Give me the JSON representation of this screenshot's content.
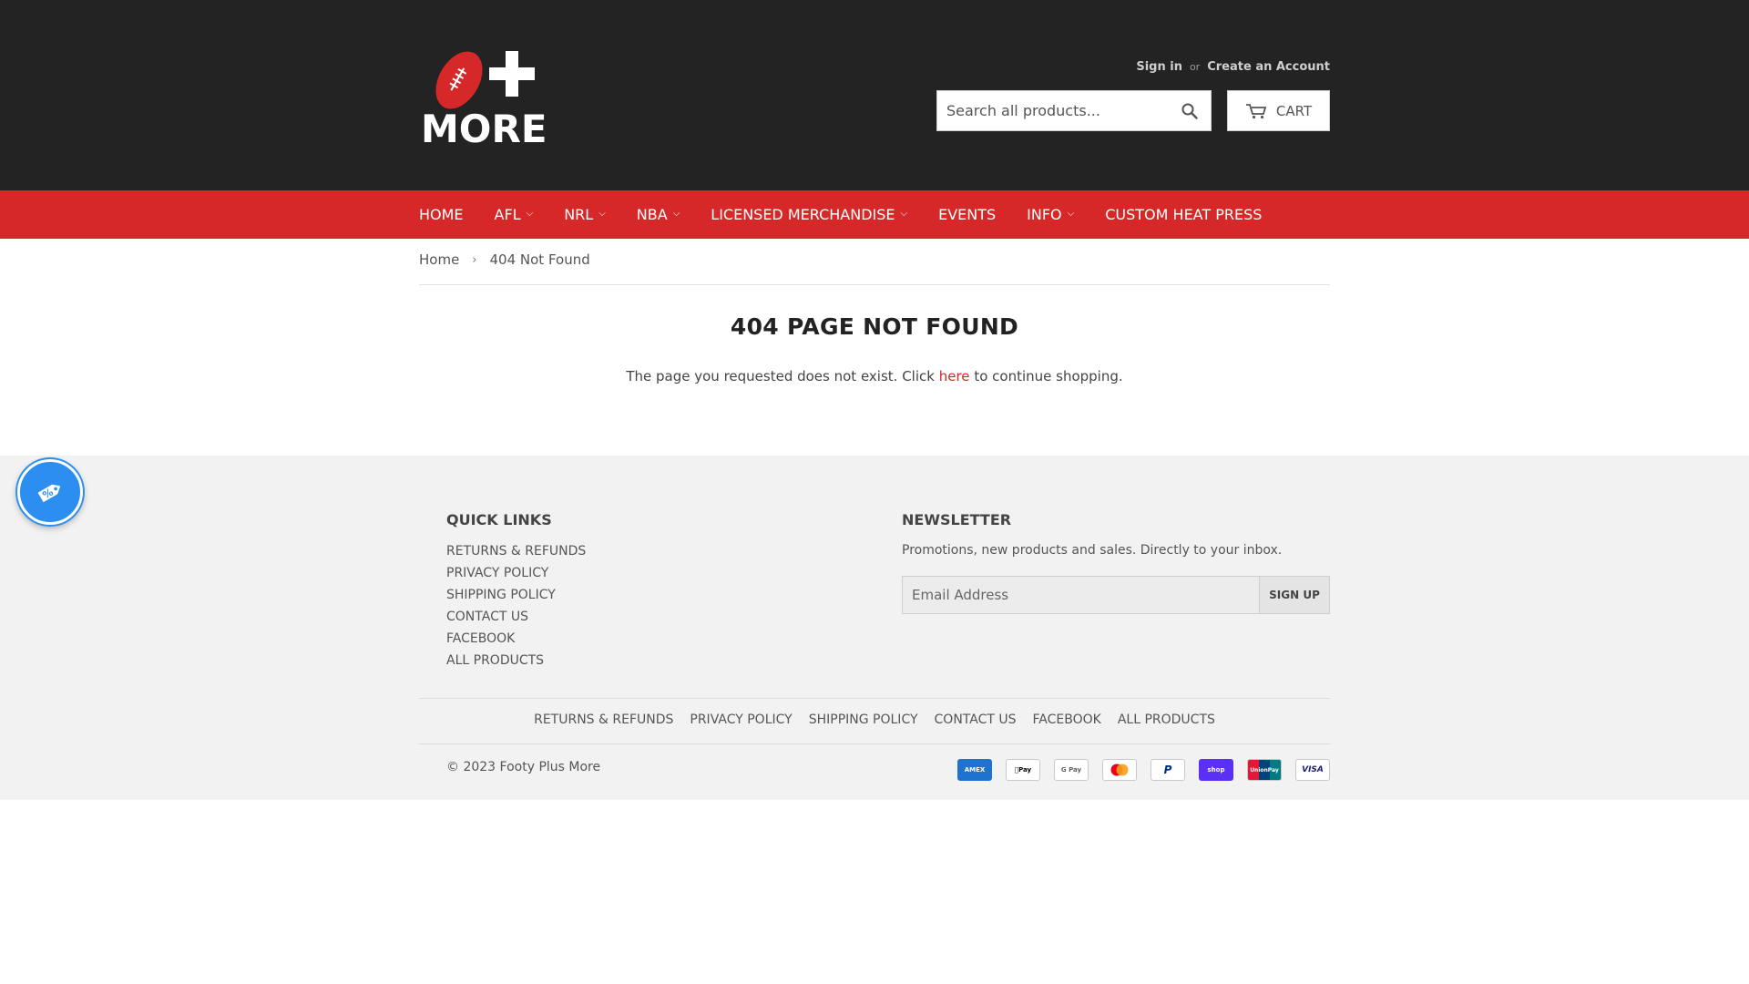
{
  "header": {
    "logo_text": "MORE",
    "sign_in": "Sign in",
    "or": "or",
    "create_account": "Create an Account",
    "search_placeholder": "Search all products...",
    "cart_label": "CART"
  },
  "nav": {
    "items": [
      {
        "label": "HOME"
      },
      {
        "label": "AFL"
      },
      {
        "label": "NRL"
      },
      {
        "label": "NBA"
      },
      {
        "label": "LICENSED MERCHANDISE"
      },
      {
        "label": "EVENTS"
      },
      {
        "label": "INFO"
      },
      {
        "label": "CUSTOM HEAT PRESS"
      }
    ]
  },
  "breadcrumb": {
    "home": "Home",
    "separator": "›",
    "current": "404 Not Found"
  },
  "main": {
    "title": "404 PAGE NOT FOUND",
    "message_before": "The page you requested does not exist. Click",
    "link": "here",
    "message_after": "to continue shopping."
  },
  "footer": {
    "quick_links_title": "QUICK LINKS",
    "quick_links": [
      "RETURNS & REFUNDS",
      "PRIVACY POLICY",
      "SHIPPING POLICY",
      "CONTACT US",
      "FACEBOOK",
      "ALL PRODUCTS"
    ],
    "newsletter_title": "NEWSLETTER",
    "newsletter_text": "Promotions, new products and sales. Directly to your inbox.",
    "email_placeholder": "Email Address",
    "signup_label": "SIGN UP",
    "bottom_links": [
      "RETURNS & REFUNDS",
      "PRIVACY POLICY",
      "SHIPPING POLICY",
      "CONTACT US",
      "FACEBOOK",
      "ALL PRODUCTS"
    ],
    "copyright": "© 2023 Footy Plus More",
    "payments": [
      {
        "name": "American Express",
        "icon": "amex-icon",
        "text": "AMEX",
        "bg": "#1f72cd",
        "fg": "#ffffff"
      },
      {
        "name": "Apple Pay",
        "icon": "apple-pay-icon",
        "text": "Pay",
        "bg": "#ffffff",
        "fg": "#000000"
      },
      {
        "name": "Google Pay",
        "icon": "google-pay-icon",
        "text": "G Pay",
        "bg": "#ffffff",
        "fg": "#5f6368"
      },
      {
        "name": "Mastercard",
        "icon": "mastercard-icon",
        "text": "",
        "bg": "#ffffff",
        "fg": "#000000"
      },
      {
        "name": "PayPal",
        "icon": "paypal-icon",
        "text": "P",
        "bg": "#ffffff",
        "fg": "#003087"
      },
      {
        "name": "Shop Pay",
        "icon": "shop-pay-icon",
        "text": "shop",
        "bg": "#5a31f4",
        "fg": "#ffffff"
      },
      {
        "name": "Union Pay",
        "icon": "union-pay-icon",
        "text": "UnionPay",
        "bg": "#ffffff",
        "fg": "#e21836"
      },
      {
        "name": "Visa",
        "icon": "visa-icon",
        "text": "VISA",
        "bg": "#ffffff",
        "fg": "#1a1f71"
      }
    ]
  },
  "colors": {
    "header_bg": "#232323",
    "nav_bg": "#d62828",
    "accent": "#d62828",
    "footer_bg": "#f2f2f2",
    "discount_badge": "#2b8ef0"
  }
}
